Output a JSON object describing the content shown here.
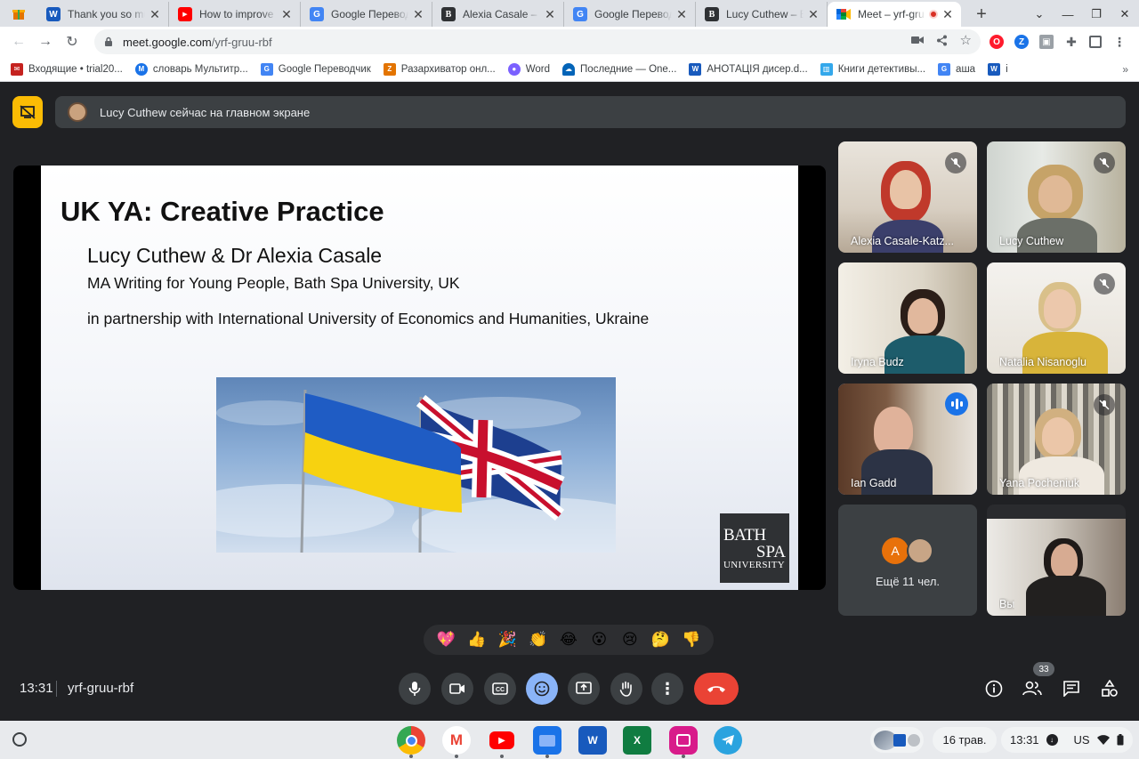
{
  "browser": {
    "tabs": [
      {
        "label": "Thank you so much",
        "favicon": "word-icon",
        "color": "#185abd"
      },
      {
        "label": "How to improve yo",
        "favicon": "youtube-icon",
        "color": "#ff0000"
      },
      {
        "label": "Google Переводчик",
        "favicon": "google-translate-icon",
        "color": "#4285f4"
      },
      {
        "label": "Alexia Casale – Ba",
        "favicon": "bathspa-icon",
        "color": "#2f3134"
      },
      {
        "label": "Google Переводчик",
        "favicon": "google-translate-icon",
        "color": "#4285f4"
      },
      {
        "label": "Lucy Cuthew – Bat",
        "favicon": "bathspa-icon",
        "color": "#2f3134"
      },
      {
        "label": "Meet – yrf-gru",
        "favicon": "meet-icon",
        "color": "#00832d",
        "active": true
      }
    ],
    "url_host": "meet.google.com",
    "url_path": "/yrf-gruu-rbf",
    "bookmarks": [
      {
        "label": "Входящие • trial20...",
        "color": "#c5221f"
      },
      {
        "label": "словарь Мультитр...",
        "color": "#1a73e8"
      },
      {
        "label": "Google Переводчик",
        "color": "#4285f4"
      },
      {
        "label": "Разархиватор онл...",
        "color": "#e37400"
      },
      {
        "label": "Word",
        "color": "#7b61ff"
      },
      {
        "label": "Последние — One...",
        "color": "#0364b8"
      },
      {
        "label": "АНОТАЦІЯ дисер.d...",
        "color": "#185abd"
      },
      {
        "label": "Книги детективы...",
        "color": "#34a8eb"
      },
      {
        "label": "аша",
        "color": "#4285f4"
      },
      {
        "label": "i",
        "color": "#185abd"
      }
    ],
    "bookmarks_more": "»"
  },
  "meet": {
    "notice": "Lucy Cuthew сейчас на главном экране",
    "slide": {
      "title": "UK YA: Creative Practice",
      "authors": "Lucy Cuthew & Dr Alexia Casale",
      "program": "MA Writing for Young People, Bath Spa University, UK",
      "partnership": "in partnership with International University of Economics and Humanities, Ukraine",
      "logo": {
        "line1": "BATH",
        "line2": "SPA",
        "line3": "UNIVERSITY"
      }
    },
    "participants": [
      {
        "name": "Alexia Casale-Katz...",
        "muted": true
      },
      {
        "name": "Lucy Cuthew",
        "muted": true
      },
      {
        "name": "Iryna Budz",
        "muted": false
      },
      {
        "name": "Natalia Nisanoglu",
        "muted": true
      },
      {
        "name": "Ian Gadd",
        "muted": false,
        "speaking": true
      },
      {
        "name": "Yana Pocheniuk",
        "muted": true
      }
    ],
    "more": {
      "avatar_letter": "A",
      "avatar_color": "#e8710a",
      "label": "Ещё 11 чел."
    },
    "self": {
      "name": "Вы"
    },
    "reactions": [
      "💖",
      "👍",
      "🎉",
      "👏",
      "😂",
      "😮",
      "😢",
      "🤔",
      "👎"
    ],
    "clock": "13:31",
    "meeting_code": "yrf-gruu-rbf",
    "participant_count": "33"
  },
  "shelf": {
    "apps": [
      {
        "name": "chrome-app"
      },
      {
        "name": "gmail-app"
      },
      {
        "name": "youtube-app"
      },
      {
        "name": "files-app"
      },
      {
        "name": "word-app",
        "letter": "W"
      },
      {
        "name": "excel-app",
        "letter": "X"
      },
      {
        "name": "gallery-app"
      },
      {
        "name": "telegram-app"
      }
    ],
    "date": "16 трав.",
    "time": "13:31",
    "locale": "US"
  }
}
